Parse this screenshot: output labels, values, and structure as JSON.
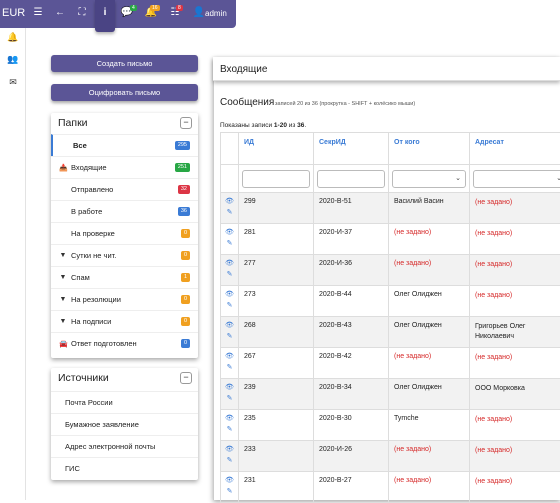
{
  "topbar": {
    "brand": "EUR",
    "icons": [
      "menu-icon",
      "arrow-left-icon",
      "fullscreen-icon",
      "info-icon",
      "comment-icon",
      "bell-icon",
      "tasks-icon",
      "user-icon"
    ],
    "badges": {
      "comments": "4",
      "bell": "16",
      "tasks": "8"
    },
    "user": "admin"
  },
  "leftstrip": {
    "icons": [
      "bell-icon",
      "users-icon",
      "envelope-icon"
    ]
  },
  "buttons": {
    "create": "Создать письмо",
    "digitize": "Оцифровать письмо"
  },
  "folders": {
    "title": "Папки",
    "collapse": "−",
    "items": [
      {
        "label": "Все",
        "count": "295",
        "color": "#3a7bd5",
        "icon": ""
      },
      {
        "label": "Входящие",
        "count": "251",
        "color": "#28a745",
        "icon": "inbox-icon"
      },
      {
        "label": "Отправлено",
        "count": "32",
        "color": "#dc3545",
        "icon": ""
      },
      {
        "label": "В работе",
        "count": "36",
        "color": "#3a7bd5",
        "icon": ""
      },
      {
        "label": "На проверке",
        "count": "0",
        "color": "#f0a020",
        "icon": ""
      },
      {
        "label": "Сутки не чит.",
        "count": "0",
        "color": "#f0a020",
        "icon": "filter-icon"
      },
      {
        "label": "Спам",
        "count": "1",
        "color": "#f0a020",
        "icon": "filter-icon"
      },
      {
        "label": "На резолюции",
        "count": "0",
        "color": "#f0a020",
        "icon": "filter-icon"
      },
      {
        "label": "На подписи",
        "count": "0",
        "color": "#f0a020",
        "icon": "filter-icon"
      },
      {
        "label": "Ответ подготовлен",
        "count": "0",
        "color": "#3a7bd5",
        "icon": "car-icon"
      }
    ]
  },
  "sources": {
    "title": "Источники",
    "collapse": "−",
    "items": [
      "Почта России",
      "Бумажное заявление",
      "Адрес электронной почты",
      "ГИС"
    ]
  },
  "main": {
    "header": "Входящие",
    "section_title": "Сообщения",
    "section_hint": "записей 20 из 36 (прокрутка - SHIFT + колёсико мыши)",
    "shown_prefix": "Показаны записи ",
    "shown_range": "1-20",
    "shown_mid": " из ",
    "shown_total": "36",
    "shown_suffix": ".",
    "columns": [
      "ИД",
      "СекрИД",
      "От кого",
      "Адресат"
    ],
    "rows": [
      {
        "id": "299",
        "secret": "2020-В-51",
        "from": "Василий Васин",
        "to": "(не задано)",
        "from_red": false,
        "to_red": true
      },
      {
        "id": "281",
        "secret": "2020-И-37",
        "from": "(не задано)",
        "to": "(не задано)",
        "from_red": true,
        "to_red": true
      },
      {
        "id": "277",
        "secret": "2020-И-36",
        "from": "(не задано)",
        "to": "(не задано)",
        "from_red": true,
        "to_red": true
      },
      {
        "id": "273",
        "secret": "2020-В-44",
        "from": "Олег Олиджен",
        "to": "(не задано)",
        "from_red": false,
        "to_red": true
      },
      {
        "id": "268",
        "secret": "2020-В-43",
        "from": "Олег Олиджен",
        "to": "Григорьев Олег Николаевич",
        "from_red": false,
        "to_red": false
      },
      {
        "id": "267",
        "secret": "2020-В-42",
        "from": "(не задано)",
        "to": "(не задано)",
        "from_red": true,
        "to_red": true
      },
      {
        "id": "239",
        "secret": "2020-В-34",
        "from": "Олег Олиджен",
        "to": "ООО Морковка",
        "from_red": false,
        "to_red": false
      },
      {
        "id": "235",
        "secret": "2020-В-30",
        "from": "Tymche",
        "to": "(не задано)",
        "from_red": false,
        "to_red": true
      },
      {
        "id": "233",
        "secret": "2020-И-26",
        "from": "(не задано)",
        "to": "(не задано)",
        "from_red": true,
        "to_red": true
      },
      {
        "id": "231",
        "secret": "2020-В-27",
        "from": "(не задано)",
        "to": "(не задано)",
        "from_red": true,
        "to_red": true
      }
    ]
  }
}
